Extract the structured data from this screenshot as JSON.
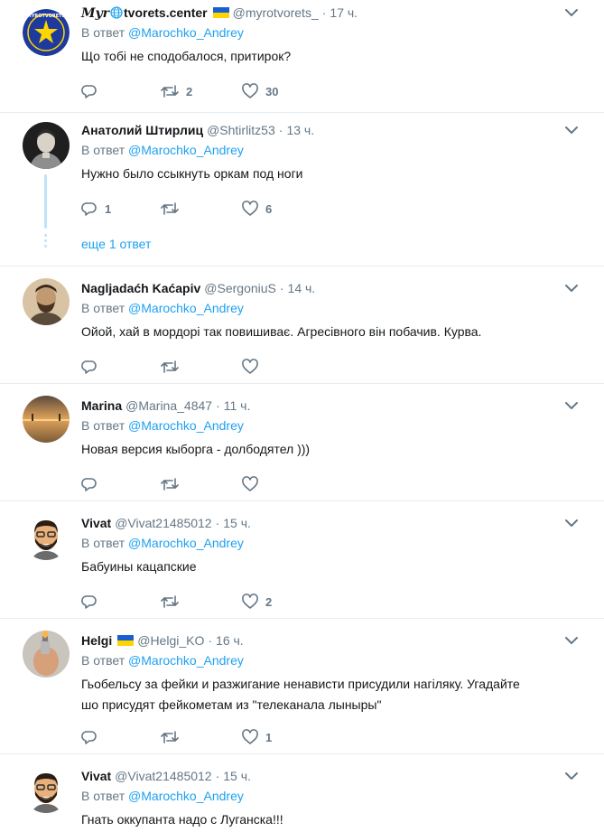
{
  "reply_prefix": "В ответ",
  "tweets": [
    {
      "name_prefix": "Myr",
      "name_suffix": "tvorets.center",
      "handle": "@myrotvorets_",
      "time": "17 ч.",
      "reply_to": "@Marochko_Andrey",
      "text": "Що тобі не сподобалося, притирок?",
      "replies": "",
      "retweets": "2",
      "likes": "30",
      "logo_text": "MYROTVORETS"
    },
    {
      "name": "Анатолий Штирлиц",
      "handle": "@Shtirlitz53",
      "time": "13 ч.",
      "reply_to": "@Marochko_Andrey",
      "text": "Нужно было ссыкнуть оркам под ноги",
      "replies": "1",
      "retweets": "",
      "likes": "6",
      "more_replies": "еще 1 ответ"
    },
    {
      "name": "Nagljadaćh Kaćapiv",
      "handle": "@SergoniuS",
      "time": "14 ч.",
      "reply_to": "@Marochko_Andrey",
      "text": "Ойой, хай в мордорі так повишиває. Агресівного він побачив. Курва.",
      "replies": "",
      "retweets": "",
      "likes": ""
    },
    {
      "name": "Marina",
      "handle": "@Marina_4847",
      "time": "11 ч.",
      "reply_to": "@Marochko_Andrey",
      "text": "Новая версия кыборга - долбодятел )))",
      "replies": "",
      "retweets": "",
      "likes": ""
    },
    {
      "name": "Vivat",
      "handle": "@Vivat21485012",
      "time": "15 ч.",
      "reply_to": "@Marochko_Andrey",
      "text": "Бабуины кацапские",
      "replies": "",
      "retweets": "",
      "likes": "2"
    },
    {
      "name": "Helgi",
      "handle": "@Helgi_KO",
      "time": "16 ч.",
      "reply_to": "@Marochko_Andrey",
      "text_line1": "Гьобельсу за фейки и разжигание ненависти присудили нагіляку. Угадайте",
      "text_line2": "шо присудят фейкометам из \"телеканала лыныры\"",
      "replies": "",
      "retweets": "",
      "likes": "1"
    },
    {
      "name": "Vivat",
      "handle": "@Vivat21485012",
      "time": "15 ч.",
      "reply_to": "@Marochko_Andrey",
      "text": "Гнать оккупанта надо с Луганска!!!"
    }
  ],
  "colors": {
    "accent": "#1da1f2",
    "muted": "#657786",
    "divider": "#e6ecf0",
    "flag_blue": "#1a5fd1",
    "flag_yellow": "#ffd500"
  },
  "icons": [
    "reply-icon",
    "retweet-icon",
    "like-icon",
    "chevron-down-icon",
    "globe-icon"
  ]
}
